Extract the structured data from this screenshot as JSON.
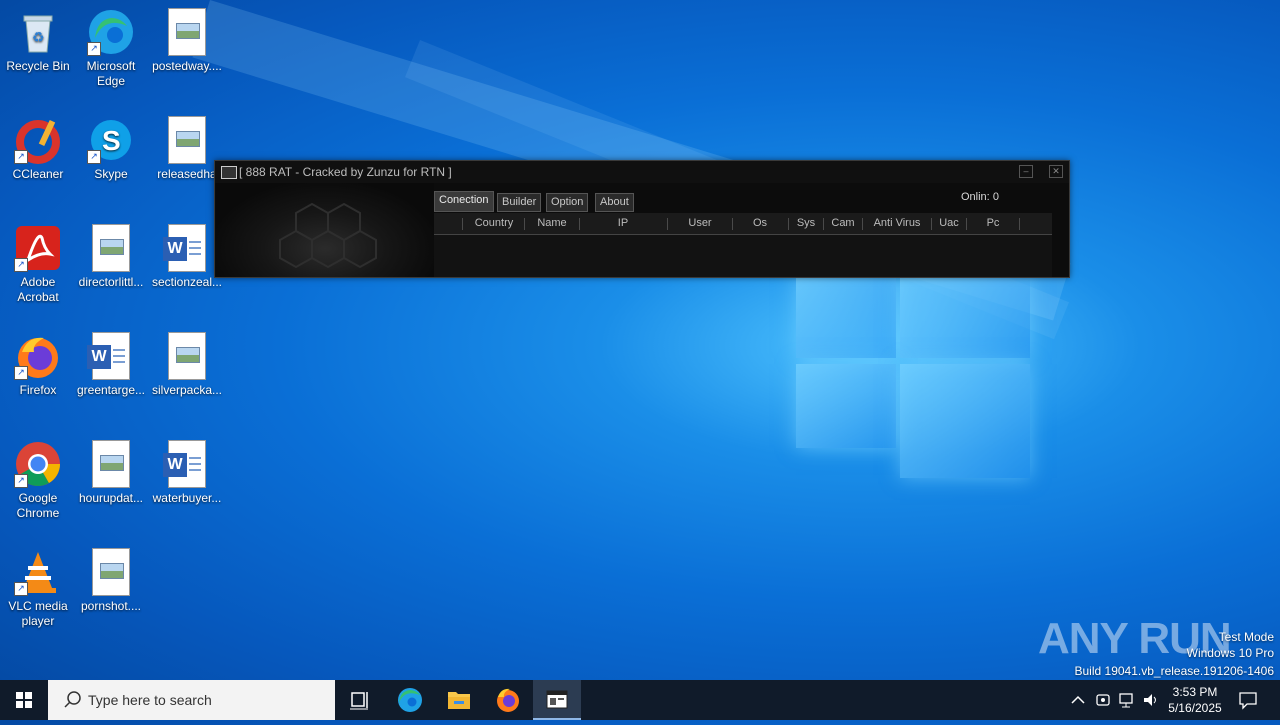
{
  "desktop": {
    "icons": [
      {
        "label": "Recycle Bin"
      },
      {
        "label": "Microsoft Edge"
      },
      {
        "label": "postedway...."
      },
      {
        "label": "CCleaner"
      },
      {
        "label": "Skype"
      },
      {
        "label": "releasedha"
      },
      {
        "label": "Adobe Acrobat"
      },
      {
        "label": "directorlittl..."
      },
      {
        "label": "sectionzeal..."
      },
      {
        "label": "Firefox"
      },
      {
        "label": "greentarge..."
      },
      {
        "label": "silverpacka..."
      },
      {
        "label": "Google Chrome"
      },
      {
        "label": "hourupdat..."
      },
      {
        "label": "waterbuyer..."
      },
      {
        "label": "VLC media player"
      },
      {
        "label": "pornshot...."
      }
    ]
  },
  "rat_window": {
    "title": "[  888 RAT - Cracked by Zunzu for RTN ]",
    "tabs": [
      "Conection",
      "Builder",
      "Option",
      "About"
    ],
    "online_label": "Onlin:",
    "online_count": "0",
    "columns": [
      "Country",
      "Name",
      "IP",
      "User",
      "Os",
      "Sys",
      "Cam",
      "Anti Virus",
      "Uac",
      "Pc"
    ]
  },
  "taskbar": {
    "search_placeholder": "Type here to search",
    "time": "3:53 PM",
    "date": "5/16/2025"
  },
  "watermark": {
    "brand": "ANY RUN",
    "line1": "Test Mode",
    "line2": "Windows 10 Pro",
    "line3": "Build 19041.vb_release.191206-1406"
  },
  "colors": {
    "desktop_blue": "#0a6fd6",
    "window_bg": "#0c0c0c",
    "taskbar_bg": "#101b2a"
  }
}
